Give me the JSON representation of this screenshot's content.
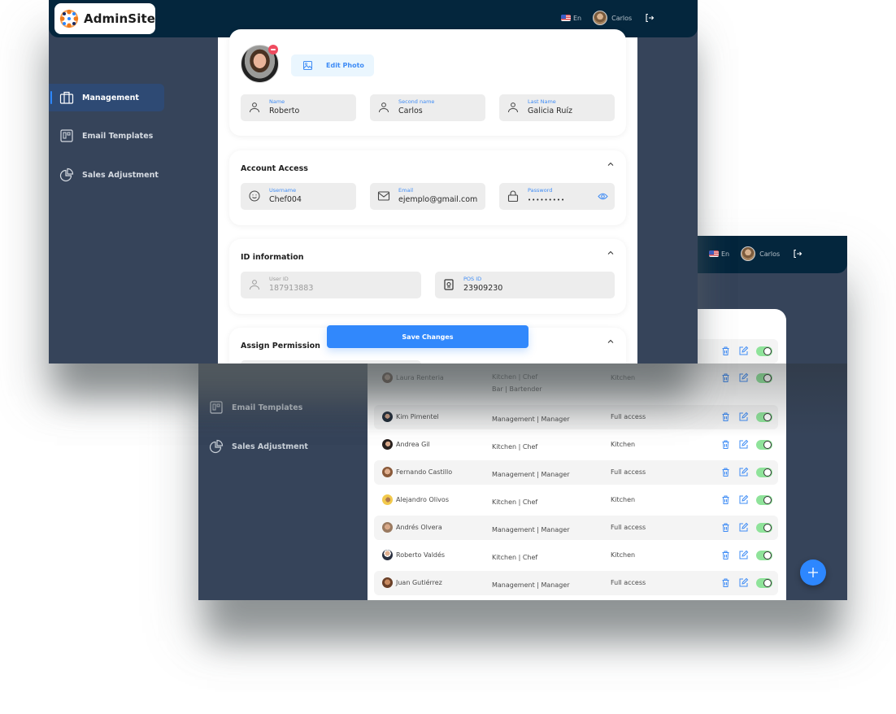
{
  "app": {
    "name": "AdminSite"
  },
  "header": {
    "language": "En",
    "user_name": "Carlos",
    "icons": [
      "us-flag-icon",
      "user-avatar",
      "logout-icon"
    ]
  },
  "sidebar": {
    "items": [
      {
        "label": "Management",
        "icon": "briefcase-icon",
        "active": true
      },
      {
        "label": "Email Templates",
        "icon": "template-icon",
        "active": false
      },
      {
        "label": "Sales Adjustment",
        "icon": "pie-chart-icon",
        "active": false
      }
    ]
  },
  "edit_user": {
    "photo": {
      "edit_label": "Edit Photo"
    },
    "personal": {
      "name": {
        "label": "Name",
        "value": "Roberto"
      },
      "second_name": {
        "label": "Second name",
        "value": "Carlos"
      },
      "last_name": {
        "label": "Last Name",
        "value": "Galicia Ruíz"
      }
    },
    "account_access": {
      "title": "Account Access",
      "username": {
        "label": "Username",
        "value": "Chef004"
      },
      "email": {
        "label": "Email",
        "value": "ejemplo@gmail.com"
      },
      "password": {
        "label": "Password",
        "value": "•••••••••"
      }
    },
    "id_information": {
      "title": "ID information",
      "user_id": {
        "label": "User ID",
        "value": "187913883"
      },
      "pos_id": {
        "label": "POS ID",
        "value": "23909230"
      }
    },
    "assign_permission": {
      "title": "Assign Permission"
    },
    "save_label": "Save Changes"
  },
  "users_list": {
    "rows": [
      {
        "name": "",
        "role": "",
        "access": "",
        "enabled": true
      },
      {
        "name": "Laura Renteria",
        "role": "Kitchen | Chef",
        "role2": "Bar | Bartender",
        "access": "Kitchen",
        "enabled": true
      },
      {
        "name": "Kim Pimentel",
        "role": "Management | Manager",
        "access": "Full access",
        "enabled": true
      },
      {
        "name": "Andrea Gil",
        "role": "Kitchen | Chef",
        "access": "Kitchen",
        "enabled": true
      },
      {
        "name": "Fernando Castillo",
        "role": "Management | Manager",
        "access": "Full access",
        "enabled": true
      },
      {
        "name": "Alejandro Olivos",
        "role": "Kitchen | Chef",
        "access": "Kitchen",
        "enabled": true
      },
      {
        "name": "Andrés Olvera",
        "role": "Management | Manager",
        "access": "Full access",
        "enabled": true
      },
      {
        "name": "Roberto Valdés",
        "role": "Kitchen | Chef",
        "access": "Kitchen",
        "enabled": true
      },
      {
        "name": "Juan Gutiérrez",
        "role": "Management | Manager",
        "access": "Full access",
        "enabled": true
      }
    ]
  },
  "colors": {
    "topbar": "#04263d",
    "sidebar": "#36445a",
    "active_nav": "#2e4a74",
    "accent": "#3188fc",
    "toggle_on": "#8fe39a",
    "danger": "#ef4b5f"
  }
}
